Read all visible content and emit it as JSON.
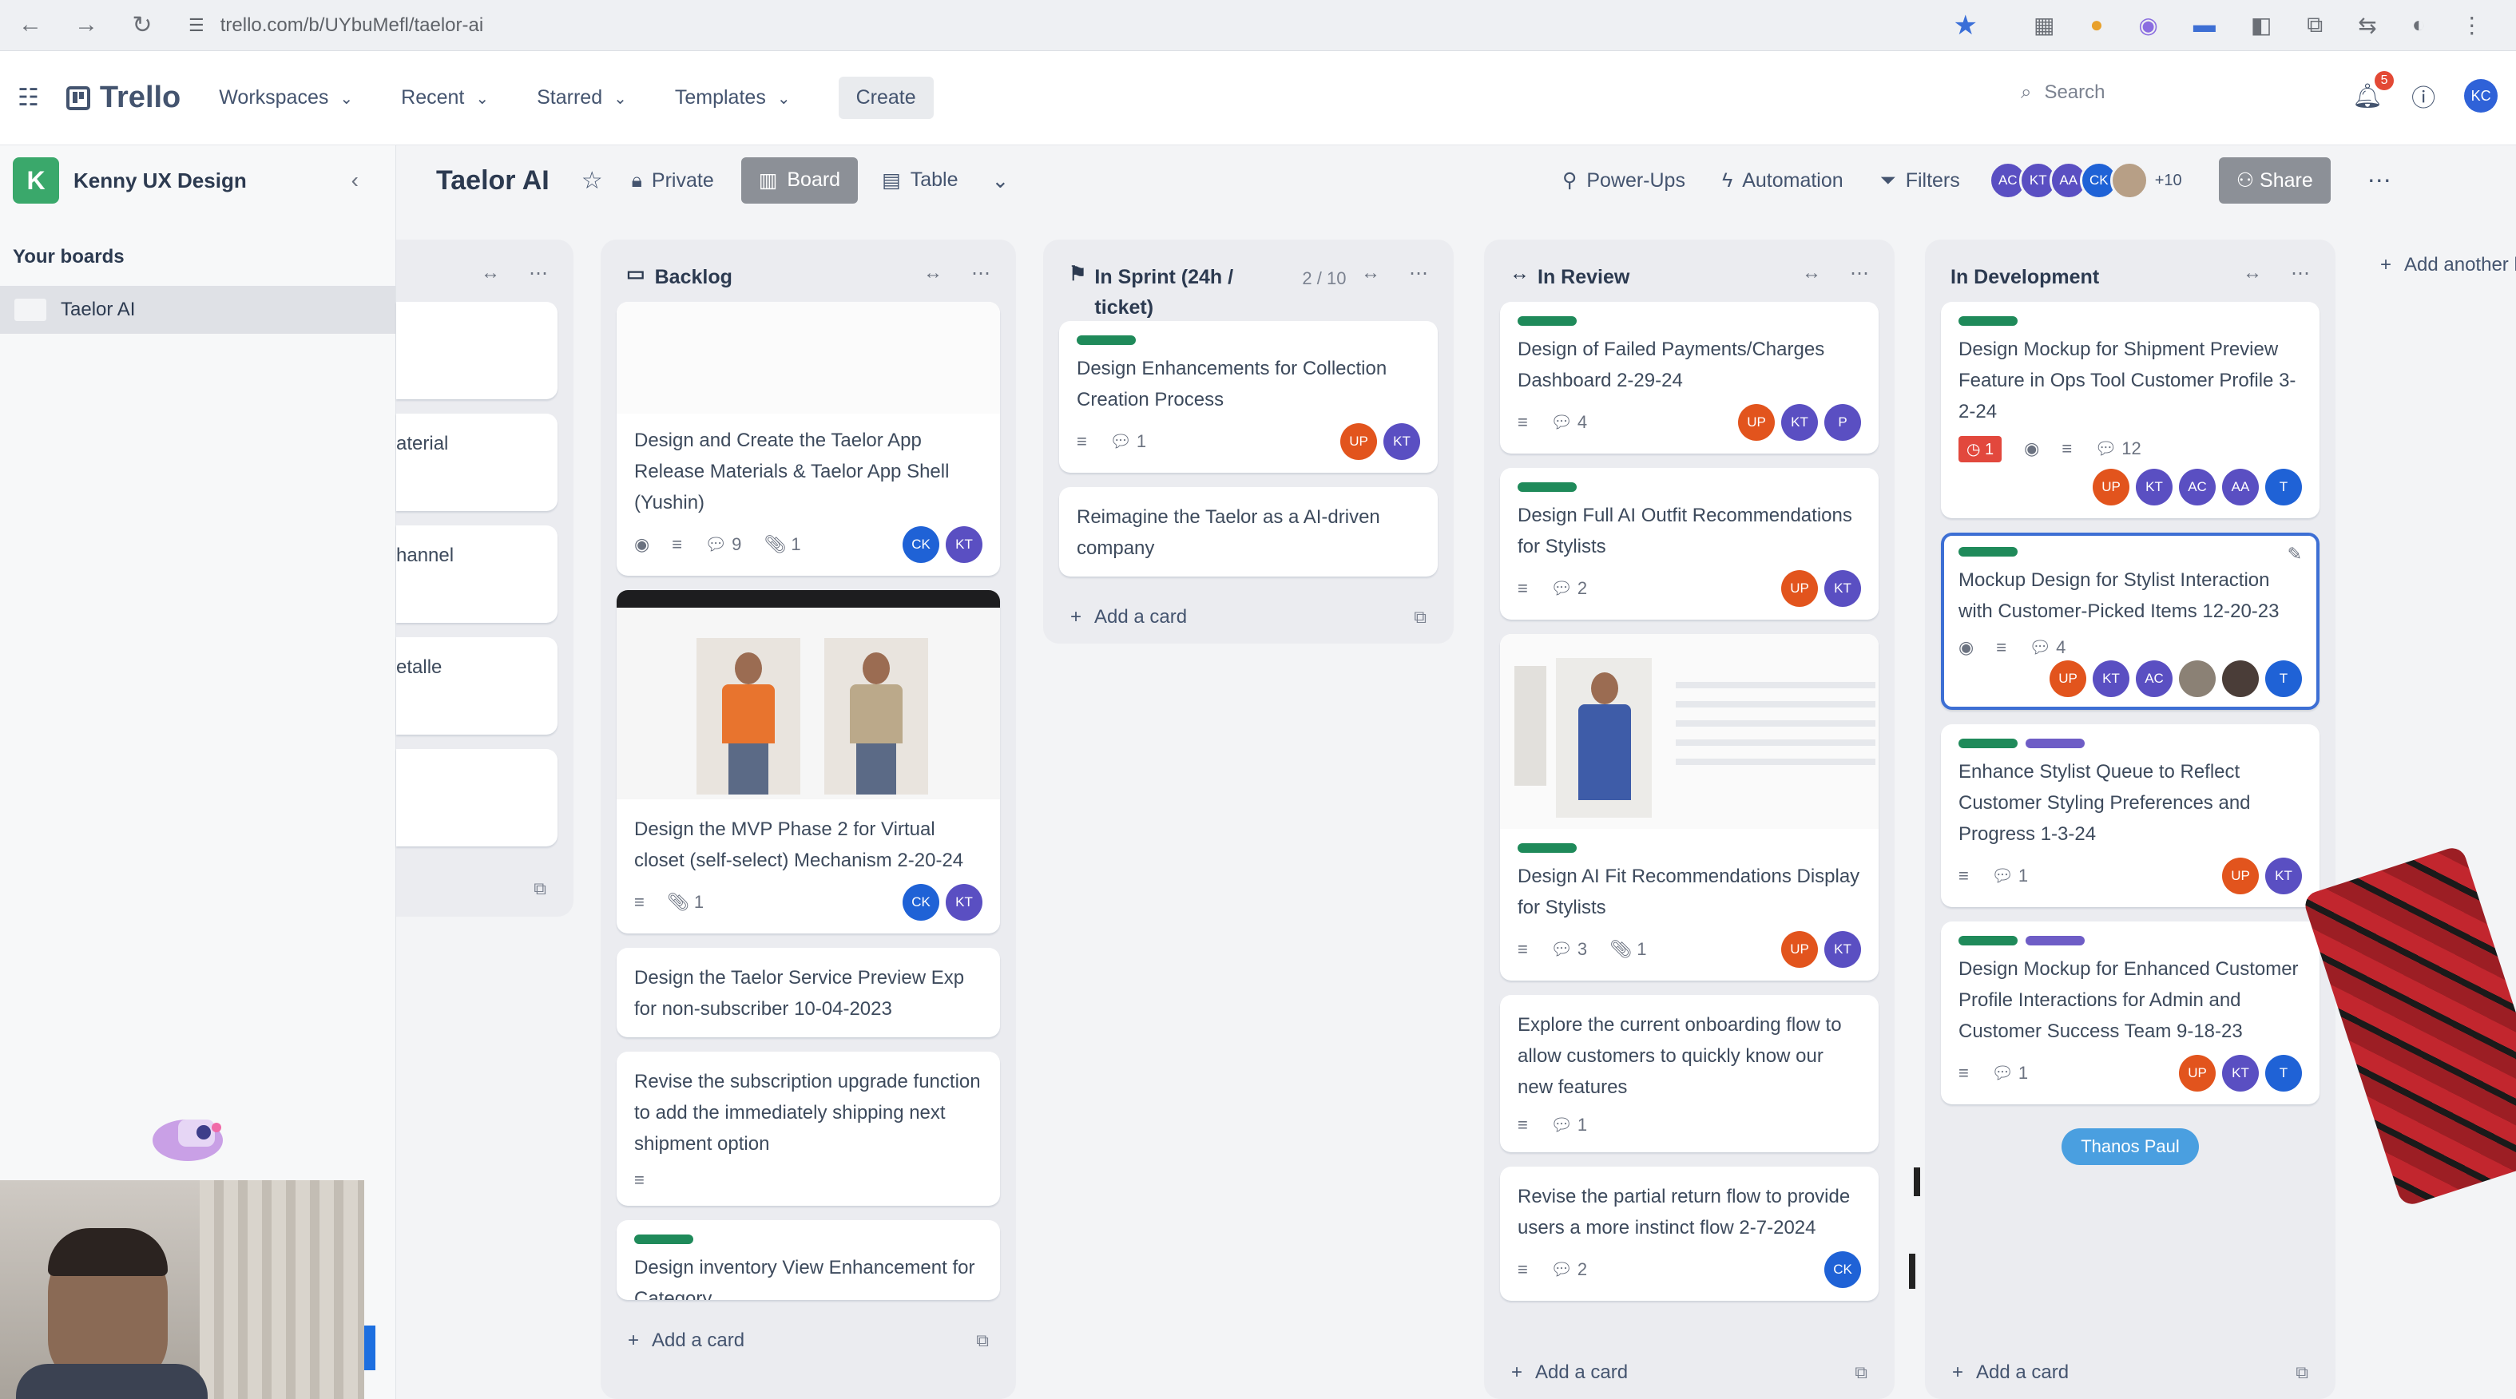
{
  "browser": {
    "url": "trello.com/b/UYbuMefl/taelor-ai",
    "nav_icons": [
      "back-icon",
      "forward-icon",
      "reload-icon"
    ]
  },
  "topnav": {
    "brand": "Trello",
    "menu": [
      {
        "label": "Workspaces"
      },
      {
        "label": "Recent"
      },
      {
        "label": "Starred"
      },
      {
        "label": "Templates"
      }
    ],
    "create_label": "Create",
    "search_placeholder": "Search",
    "notifications_count": "5",
    "user_initials": "KC"
  },
  "sidebar": {
    "workspace_initial": "K",
    "workspace_name": "Kenny UX Design",
    "section_title": "Your boards",
    "boards": [
      {
        "label": "Taelor AI"
      }
    ]
  },
  "board": {
    "title": "Taelor AI",
    "visibility": "Private",
    "view_board": "Board",
    "view_table": "Table",
    "powerups": "Power-Ups",
    "automation": "Automation",
    "filters": "Filters",
    "members_more": "+10",
    "share": "Share",
    "members": [
      {
        "initials": "AC",
        "color": "#5a4fc2"
      },
      {
        "initials": "KT",
        "color": "#5a4fc2"
      },
      {
        "initials": "AA",
        "color": "#5a4fc2"
      },
      {
        "initials": "CK",
        "color": "#1f62d6"
      },
      {
        "initials": "",
        "color": "#b79f86"
      }
    ]
  },
  "lists": {
    "partial": {
      "cards": [
        {
          "title": ""
        },
        {
          "title": "aterial"
        },
        {
          "title": "hannel"
        },
        {
          "title": "etalle"
        },
        {
          "title": ""
        }
      ]
    },
    "backlog": {
      "title": "Backlog",
      "add_card": "Add a card",
      "cards": [
        {
          "title": "Design and Create the Taelor App Release Materials & Taelor App Shell (Yushin)",
          "comments": "9",
          "attachments": "1"
        },
        {
          "title": "Design the MVP Phase 2 for Virtual closet (self-select) Mechanism 2-20-24",
          "attachments": "1"
        },
        {
          "title": "Design the Taelor Service Preview Exp for non-subscriber 10-04-2023"
        },
        {
          "title": "Revise the subscription upgrade function to add the immediately shipping next shipment option"
        },
        {
          "title": "Design inventory View Enhancement for Category"
        }
      ]
    },
    "in_sprint": {
      "title": "In Sprint (24h / ticket)",
      "count": "2 / 10",
      "add_card": "Add a card",
      "cards": [
        {
          "title": "Design Enhancements for Collection Creation Process",
          "comments": "1"
        },
        {
          "title": "Reimagine the Taelor as a AI-driven company"
        }
      ]
    },
    "in_review": {
      "title": "In Review",
      "add_card": "Add a card",
      "cards": [
        {
          "title": "Design of Failed Payments/Charges Dashboard 2-29-24",
          "comments": "4"
        },
        {
          "title": "Design Full AI Outfit Recommendations for Stylists",
          "comments": "2"
        },
        {
          "title": "Design AI Fit Recommendations Display for Stylists",
          "comments": "3",
          "attachments": "1"
        },
        {
          "title": "Explore the current onboarding flow to allow customers to quickly know our new features",
          "comments": "1"
        },
        {
          "title": "Revise the partial return flow to provide users a more instinct flow 2-7-2024",
          "comments": "2"
        }
      ]
    },
    "in_development": {
      "title": "In Development",
      "add_card": "Add a card",
      "cards": [
        {
          "title": "Design Mockup for Shipment Preview Feature in Ops Tool Customer Profile 3-2-24",
          "due": "1",
          "comments": "12"
        },
        {
          "title": "Mockup Design for Stylist Interaction with Customer-Picked Items 12-20-23",
          "comments": "4"
        },
        {
          "title": "Enhance Stylist Queue to Reflect Customer Styling Preferences and Progress 1-3-24",
          "comments": "1"
        },
        {
          "title": "Design Mockup for Enhanced Customer Profile Interactions for Admin and Customer Success Team 9-18-23",
          "comments": "1"
        }
      ]
    },
    "add_another": "Add another list"
  },
  "cursor_label": "Thanos Paul",
  "colors": {
    "accent_green": "#1f8a5a",
    "accent_purple": "#6e5dc6",
    "member_orange": "#e2541d",
    "member_purple": "#5a4fc2",
    "member_blue": "#1f62d6"
  }
}
